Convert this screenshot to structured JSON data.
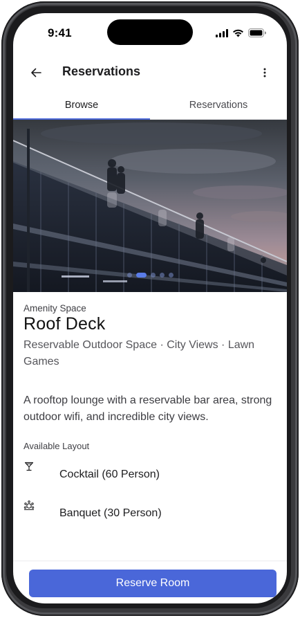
{
  "status_bar": {
    "time": "9:41",
    "icons": [
      "cellular-signal-icon",
      "wifi-icon",
      "battery-icon"
    ]
  },
  "app_bar": {
    "title": "Reservations",
    "back_icon": "arrow-left-icon",
    "more_icon": "more-vertical-icon"
  },
  "tabs": [
    {
      "label": "Browse",
      "active": true
    },
    {
      "label": "Reservations",
      "active": false
    }
  ],
  "hero": {
    "carousel_total": 5,
    "carousel_active_index": 1
  },
  "amenity": {
    "eyebrow": "Amenity Space",
    "name": "Roof Deck",
    "tags": "Reservable Outdoor Space · City Views · Lawn Games",
    "description": "A rooftop lounge with a reservable bar area, strong outdoor wifi, and incredible city views."
  },
  "layouts": {
    "label": "Available Layout",
    "items": [
      {
        "icon": "cocktail-glass-icon",
        "label": "Cocktail (60 Person)"
      },
      {
        "icon": "banquet-table-icon",
        "label": "Banquet (30 Person)"
      }
    ]
  },
  "actions": {
    "reserve_label": "Reserve Room"
  },
  "colors": {
    "accent": "#4a67d9",
    "text_primary": "#1d1d1f",
    "text_secondary": "#55555a"
  }
}
